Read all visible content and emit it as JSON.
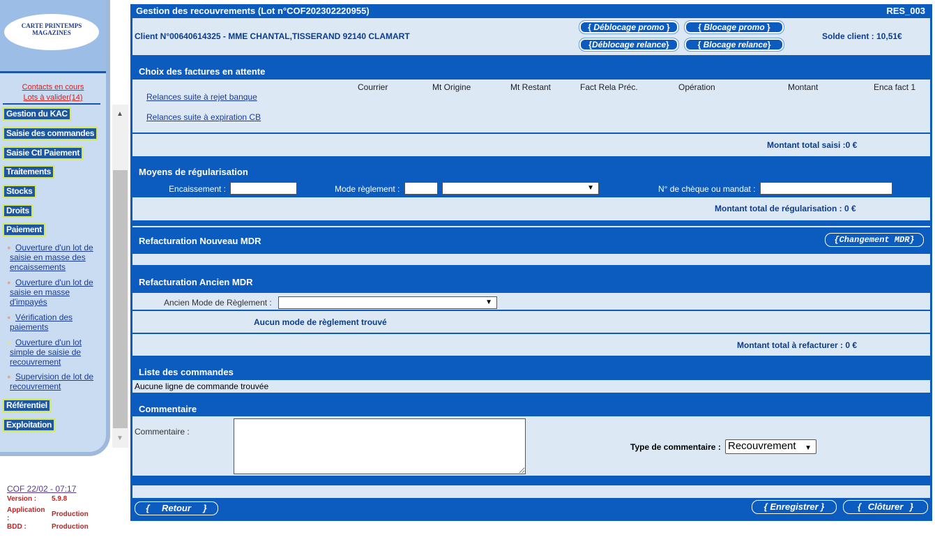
{
  "sidebar": {
    "logo_line1": "CARTE PRINTEMPS",
    "logo_line2": "MAGAZINES",
    "link_contacts": "Contacts en cours",
    "link_lots": "Lots à valider(14)",
    "menu": [
      "Gestion du KAC",
      "Saisie des commandes",
      "Saisie Ctl Paiement",
      "Traitements",
      "Stocks",
      "Droits",
      "Paiement"
    ],
    "sub_items": [
      "Ouverture d'un lot de saisie en masse des encaissements",
      "Ouverture d'un lot de saisie en masse d'impayés",
      "Vérification des paiements",
      "Ouverture d'un lot simple de saisie de recouvrement",
      "Supervision de lot de recouvrement"
    ],
    "menu_bottom": [
      "Référentiel",
      "Exploitation"
    ],
    "footer": {
      "date": "COF 22/02 - 07:17",
      "version_label": "Version :",
      "version_value": "5.9.8",
      "app_label": "Application :",
      "app_value": "Production",
      "bdd_label": "BDD :",
      "bdd_value": "Production"
    }
  },
  "header": {
    "title": "Gestion des recouvrements (Lot n°COF202302220955)",
    "code": "RES_003",
    "client": "Client N°00640614325 - MME CHANTAL,TISSERAND 92140 CLAMART",
    "solde": "Solde client : 10,51€",
    "btn_deblocage_promo": "Déblocage promo",
    "btn_blocage_promo": "Blocage promo",
    "btn_deblocage_relance": "Déblocage relance",
    "btn_blocage_relance": "Blocage relance"
  },
  "factures": {
    "title": "Choix des factures en attente",
    "columns": [
      "Courrier",
      "Mt Origine",
      "Mt Restant",
      "Fact Rela Préc.",
      "Opération",
      "Montant",
      "Enca fact 1"
    ],
    "link_rejet": "Relances suite à rejet banque",
    "link_expiration": "Relances suite à expiration CB",
    "total": "Montant total saisi :0 €"
  },
  "regularisation": {
    "title": "Moyens de régularisation",
    "encaissement_label": "Encaissement :",
    "encaissement_value": "",
    "mode_label": "Mode règlement :",
    "mode_value": "",
    "cheque_label": "N° de chèque ou mandat :",
    "cheque_value": "",
    "total": "Montant total de régularisation : 0 €"
  },
  "nouveau_mdr": {
    "title": "Refacturation Nouveau MDR",
    "btn_changement": "Changement MDR"
  },
  "ancien_mdr": {
    "title": "Refacturation Ancien MDR",
    "mode_label": "Ancien Mode de Règlement :",
    "none_msg": "Aucun mode de règlement trouvé",
    "total": "Montant total à refacturer : 0 €"
  },
  "commandes": {
    "title": "Liste des commandes",
    "empty": "Aucune ligne de commande trouvée"
  },
  "commentaire": {
    "title": "Commentaire",
    "label": "Commentaire :",
    "value": "",
    "type_label": "Type de commentaire :",
    "type_value": "Recouvrement"
  },
  "footer_buttons": {
    "retour": "Retour",
    "enregistrer": "Enregistrer",
    "cloturer": "Clôturer"
  },
  "colors": {
    "primary_blue": "#0c5cbf",
    "panel_bg": "#dde8f5",
    "sidebar_bg": "#c9dcf1",
    "link_red": "#d0201f",
    "menu_border": "#d6e64e"
  }
}
